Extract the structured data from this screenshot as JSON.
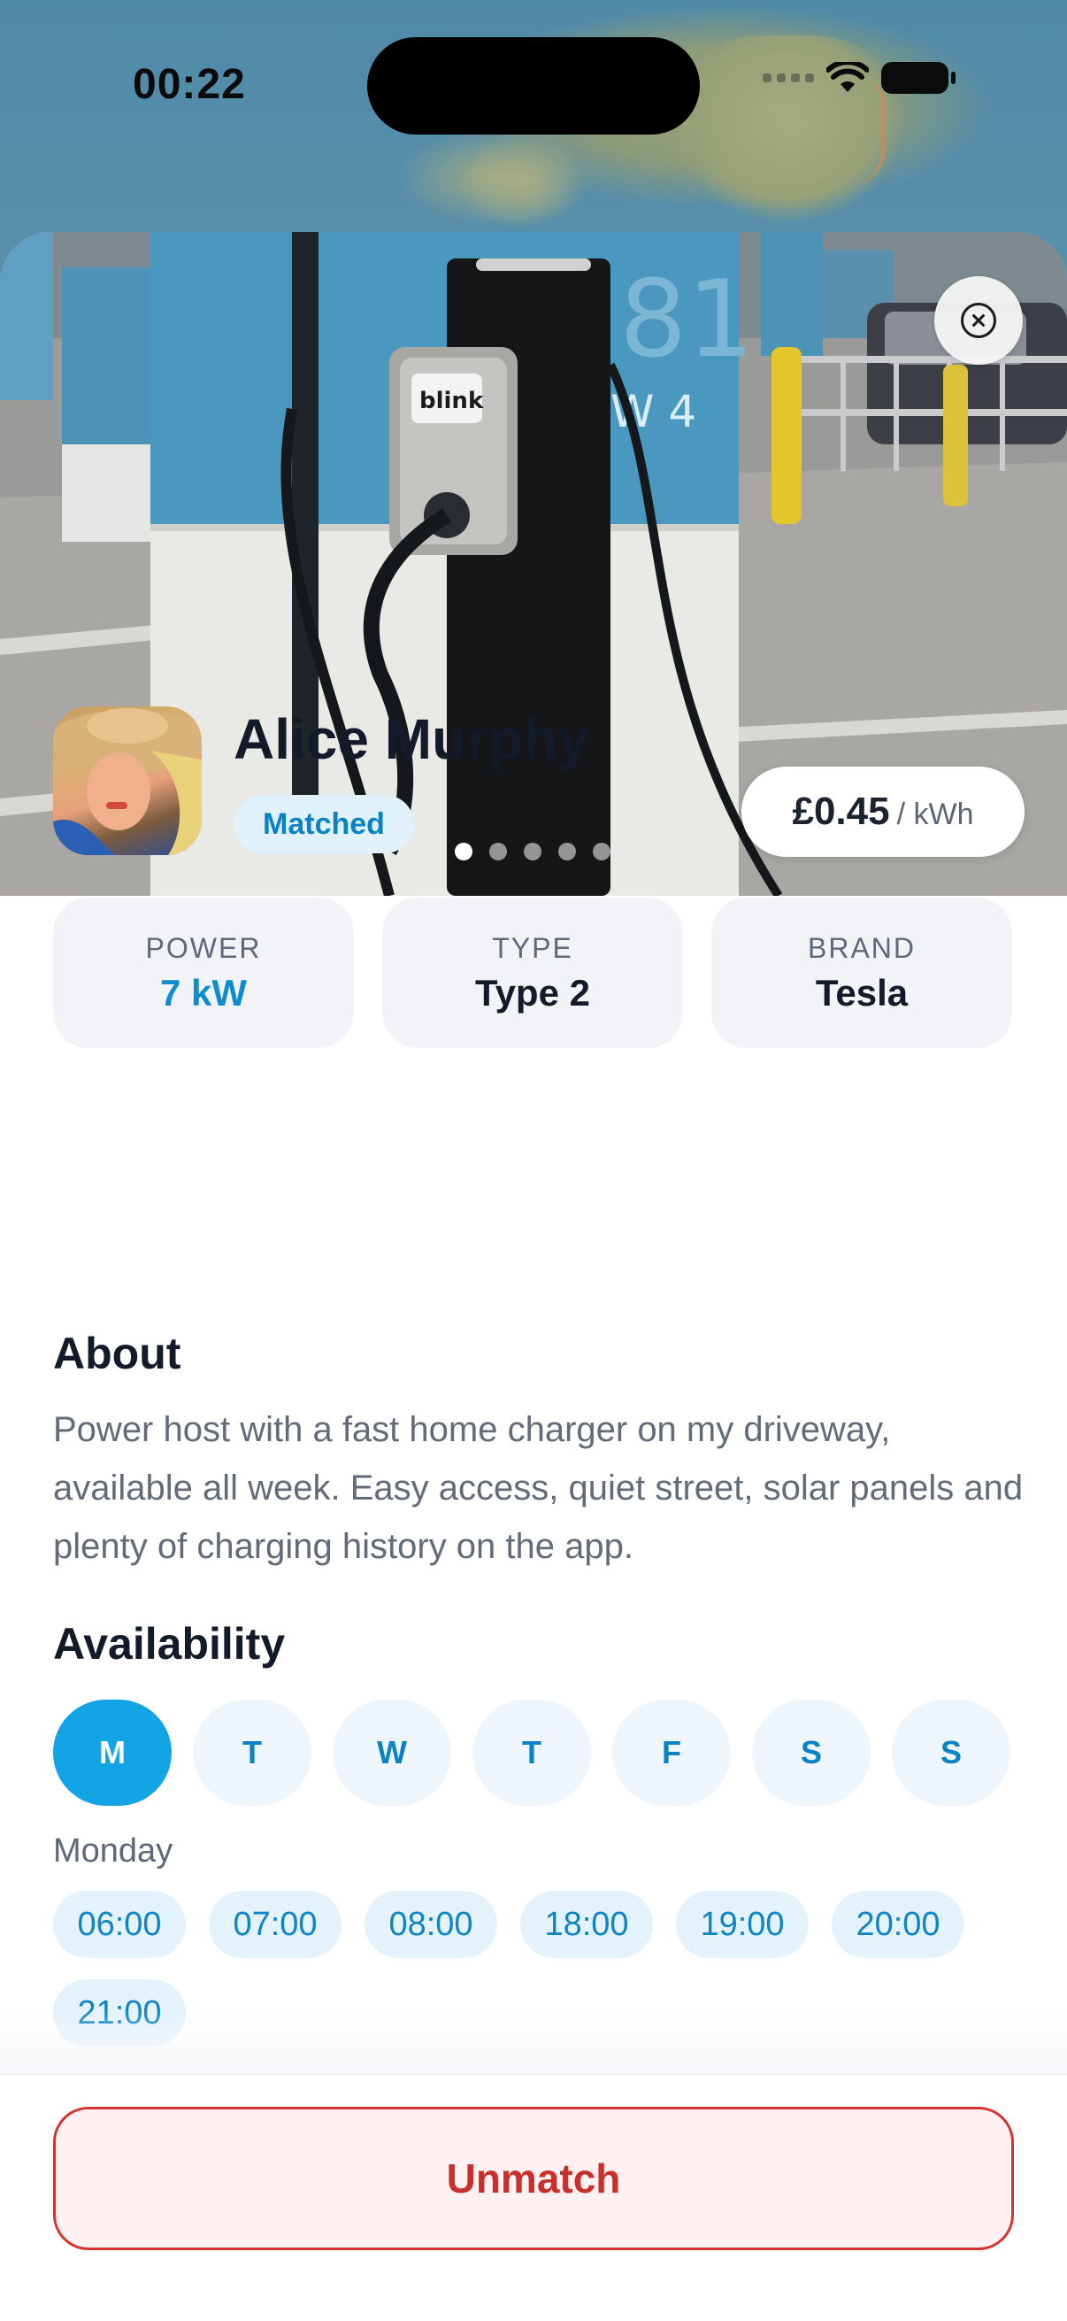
{
  "status_bar": {
    "time": "00:22",
    "icons": [
      "signal-icon",
      "wifi-icon",
      "battery-icon"
    ]
  },
  "listing": {
    "photo_description_icon": "charger-photo",
    "photo_count": 5,
    "active_photo_index": 0,
    "price": {
      "value": "£0.45",
      "unit": "/ kWh"
    }
  },
  "host": {
    "name": "Alice Murphy",
    "status_badge": "Matched"
  },
  "specs": [
    {
      "label": "POWER",
      "value": "7 kW"
    },
    {
      "label": "TYPE",
      "value": "Type 2"
    },
    {
      "label": "BRAND",
      "value": "Tesla"
    }
  ],
  "about": {
    "title": "About",
    "text": "Power host with a fast home charger on my driveway, available all week. Easy access, quiet street, solar panels and plenty of charging history on the app."
  },
  "availability": {
    "title": "Availability",
    "days": [
      "M",
      "T",
      "W",
      "T",
      "F",
      "S",
      "S"
    ],
    "selected_day_index": 0,
    "selected_day_name": "Monday",
    "slots": [
      "06:00",
      "07:00",
      "08:00",
      "18:00",
      "19:00",
      "20:00",
      "21:00"
    ]
  },
  "actions": {
    "unmatch_label": "Unmatch"
  },
  "colors": {
    "accent": "#13a4e6",
    "danger": "#d8322e",
    "badge_bg": "#e1f1fc"
  }
}
